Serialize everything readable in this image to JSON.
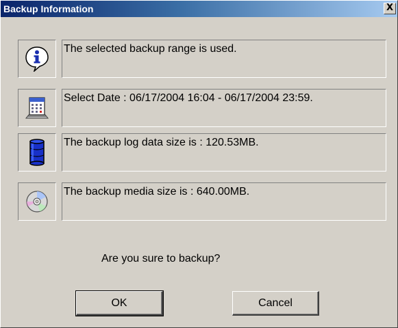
{
  "window": {
    "title": "Backup Information",
    "close_glyph": "X"
  },
  "rows": [
    {
      "icon": "info-icon",
      "text": "The selected backup range is used."
    },
    {
      "icon": "calendar-icon",
      "text": "Select Date : 06/17/2004 16:04 - 06/17/2004 23:59."
    },
    {
      "icon": "database-icon",
      "text": "The backup log data size is : 120.53MB."
    },
    {
      "icon": "cd-disc-icon",
      "text": "The backup media size is : 640.00MB."
    }
  ],
  "question": "Are you sure to backup?",
  "buttons": {
    "ok": "OK",
    "cancel": "Cancel"
  },
  "colors": {
    "dialog_bg": "#d4d0c8",
    "titlebar_start": "#0a246a",
    "titlebar_end": "#a6caf0"
  }
}
